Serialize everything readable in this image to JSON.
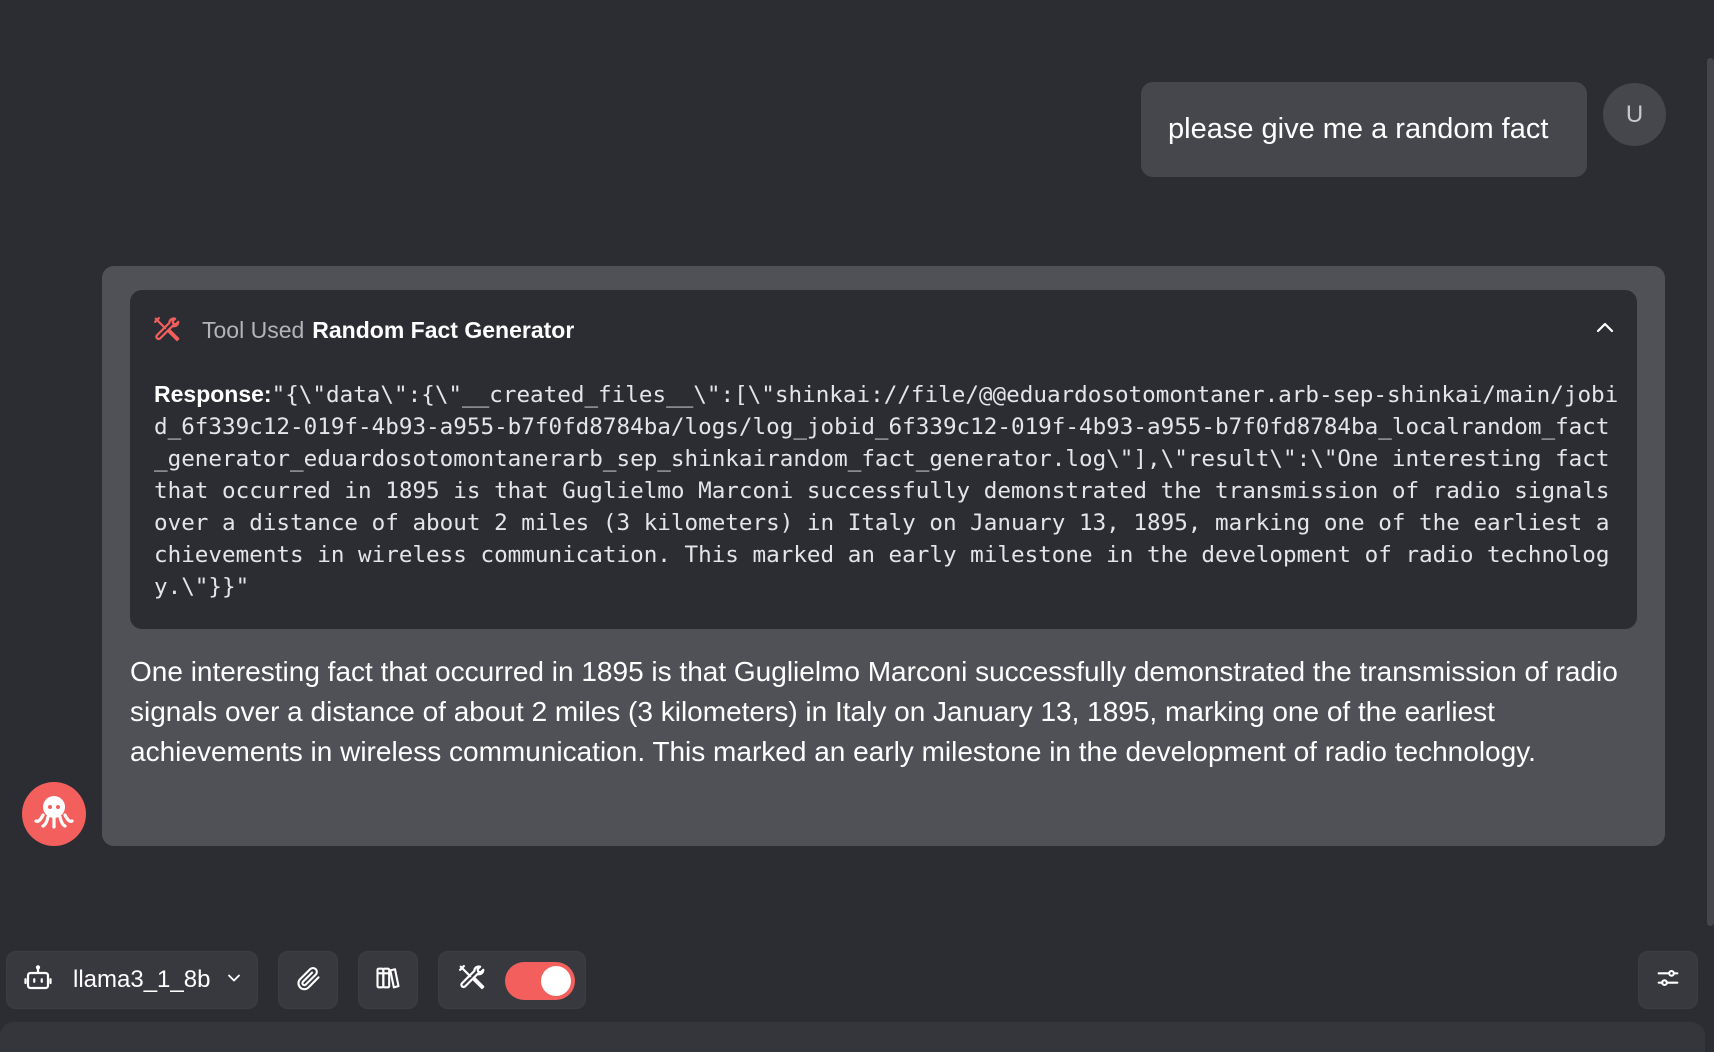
{
  "user_message": {
    "text": "please give me a random fact",
    "avatar_letter": "U"
  },
  "assistant_message": {
    "tool": {
      "used_label": "Tool Used",
      "name": "Random Fact Generator",
      "response_label": "Response:",
      "response_text": "\"{\\\"data\\\":{\\\"__created_files__\\\":[\\\"shinkai://file/@@eduardosotomontaner.arb-sep-shinkai/main/jobid_6f339c12-019f-4b93-a955-b7f0fd8784ba/logs/log_jobid_6f339c12-019f-4b93-a955-b7f0fd8784ba_localrandom_fact_generator_eduardosotomontanerarb_sep_shinkairandom_fact_generator.log\\\"],\\\"result\\\":\\\"One interesting fact that occurred in 1895 is that Guglielmo Marconi successfully demonstrated the transmission of radio signals over a distance of about 2 miles (3 kilometers) in Italy on January 13, 1895, marking one of the earliest achievements in wireless communication. This marked an early milestone in the development of radio technology.\\\"}}\"",
      "icon": "tools-icon",
      "expanded": true
    },
    "text": "One interesting fact that occurred in 1895 is that Guglielmo Marconi successfully demonstrated the transmission of radio signals over a distance of about 2 miles (3 kilometers) in Italy on January 13, 1895, marking one of the earliest achievements in wireless communication. This marked an early milestone in the development of radio technology.",
    "avatar_icon": "octopus-icon"
  },
  "toolbar": {
    "model_name": "llama3_1_8b",
    "model_icon": "robot-icon",
    "attach_icon": "paperclip-icon",
    "library_icon": "books-icon",
    "tools_icon": "tools-icon",
    "tools_enabled": true,
    "settings_icon": "sliders-icon"
  },
  "colors": {
    "background": "#2c2d32",
    "accent": "#f25f5c",
    "card": "#505157",
    "bubble": "#46474d"
  }
}
